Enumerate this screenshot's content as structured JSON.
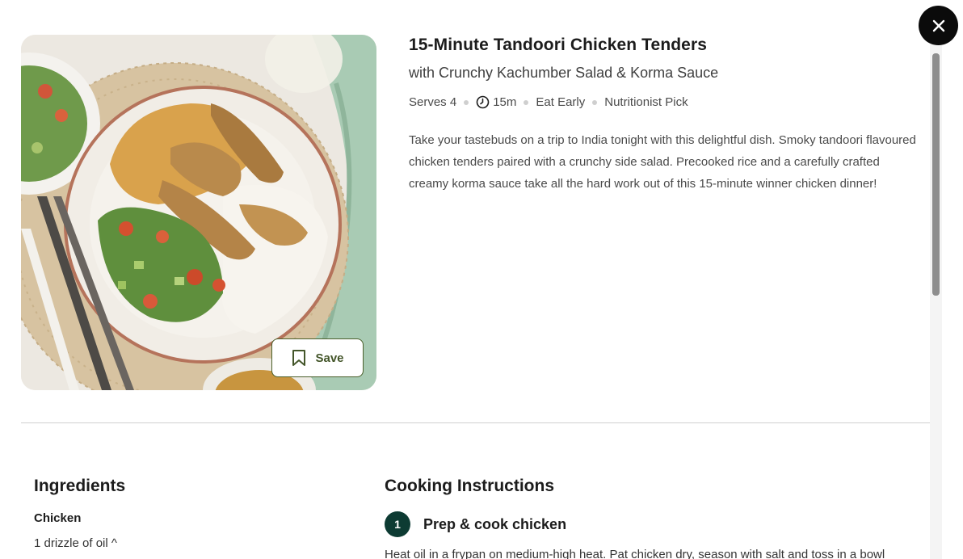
{
  "recipe": {
    "title": "15-Minute Tandoori Chicken Tenders",
    "subtitle": "with Crunchy Kachumber Salad & Korma Sauce",
    "meta": {
      "serves": "Serves 4",
      "time": "15m",
      "tag1": "Eat Early",
      "tag2": "Nutritionist Pick"
    },
    "description": "Take your tastebuds on a trip to India tonight with this delightful dish. Smoky tandoori flavoured chicken tenders paired with a crunchy side salad. Precooked rice and a carefully crafted creamy korma sauce take all the hard work out of this 15-minute winner chicken dinner!",
    "save_label": "Save"
  },
  "ingredients": {
    "heading": "Ingredients",
    "groups": [
      {
        "name": "Chicken",
        "items": [
          "1 drizzle of oil ^"
        ]
      }
    ]
  },
  "instructions": {
    "heading": "Cooking Instructions",
    "steps": [
      {
        "number": "1",
        "title": "Prep & cook chicken",
        "text": "Heat oil in a frypan on medium-high heat. Pat chicken dry, season with salt and toss in a bowl"
      }
    ]
  },
  "icons": {
    "close": "close-icon",
    "save": "bookmark-icon",
    "time": "clock-icon"
  },
  "colors": {
    "accent_green": "#44562a",
    "step_badge": "#0d3b33",
    "close_button": "#0b0b0b"
  }
}
